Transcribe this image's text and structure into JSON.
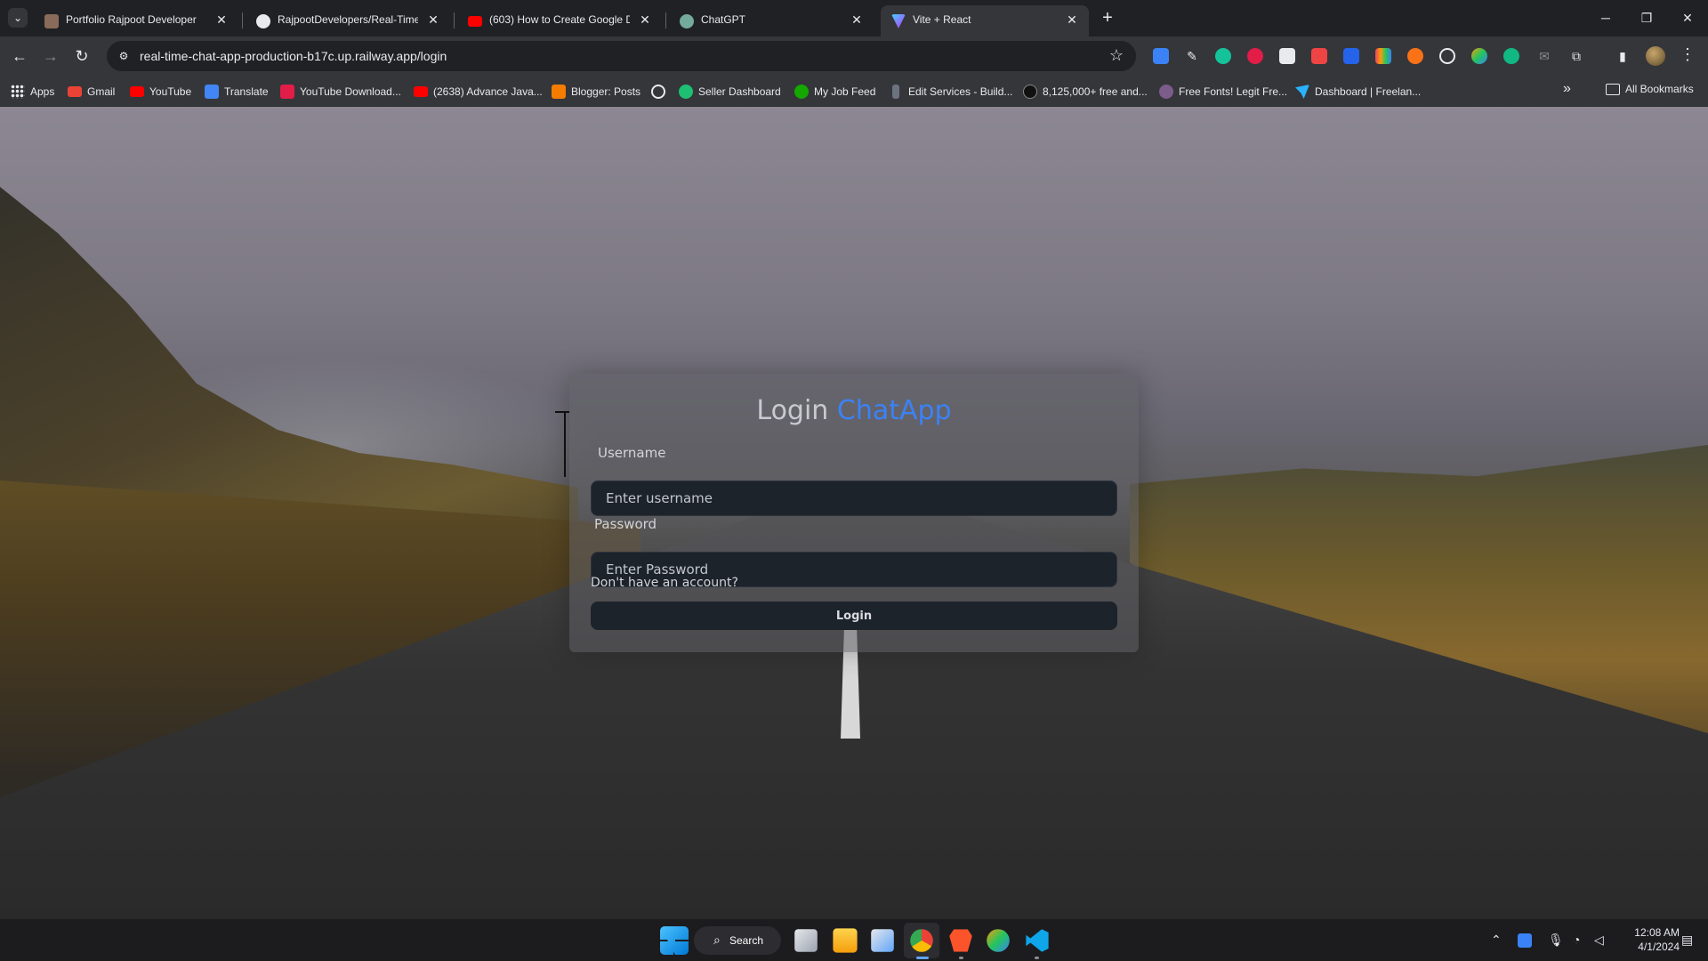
{
  "browser": {
    "tabs": [
      {
        "title": "Portfolio Rajpoot Developer",
        "icon": "portfolio-favicon",
        "color": "#8a6a5a"
      },
      {
        "title": "RajpootDevelopers/Real-Time-",
        "icon": "github-icon",
        "color": "#e8eaed"
      },
      {
        "title": "(603) How to Create Google Dr",
        "icon": "youtube-icon",
        "color": "#ff0000"
      },
      {
        "title": "ChatGPT",
        "icon": "chatgpt-icon",
        "color": "#74aa9c"
      },
      {
        "title": "Vite + React",
        "icon": "vite-icon",
        "color": "#a855f7"
      }
    ],
    "active_tab_index": 4,
    "address_bar": {
      "url": "real-time-chat-app-production-b17c.up.railway.app/login"
    },
    "bookmarks": [
      {
        "label": "Apps",
        "icon": "apps-grid-icon"
      },
      {
        "label": "Gmail",
        "icon": "gmail-icon"
      },
      {
        "label": "YouTube",
        "icon": "youtube-icon"
      },
      {
        "label": "Translate",
        "icon": "translate-icon"
      },
      {
        "label": "YouTube Download...",
        "icon": "download-icon"
      },
      {
        "label": "(2638) Advance Java...",
        "icon": "youtube-icon"
      },
      {
        "label": "Blogger: Posts",
        "icon": "blogger-icon"
      },
      {
        "label": "",
        "icon": "globe-icon"
      },
      {
        "label": "Seller Dashboard",
        "icon": "fiverr-icon"
      },
      {
        "label": "My Job Feed",
        "icon": "upwork-icon"
      },
      {
        "label": "Edit Services - Build...",
        "icon": "service-icon"
      },
      {
        "label": "8,125,000+ free and...",
        "icon": "freepik-icon"
      },
      {
        "label": "Free Fonts! Legit Fre...",
        "icon": "fonts-icon"
      },
      {
        "label": "Dashboard | Freelan...",
        "icon": "freelancer-icon"
      }
    ],
    "all_bookmarks_label": "All Bookmarks"
  },
  "login": {
    "title_prefix": "Login",
    "title_brand": "ChatApp",
    "username_label": "Username",
    "username_placeholder": "Enter username",
    "password_label": "Password",
    "password_placeholder": "Enter Password",
    "signup_link": "Don't have an account?",
    "submit_label": "Login",
    "brand_color": "#3b82f6"
  },
  "taskbar": {
    "search_label": "Search",
    "time": "12:08 AM",
    "date": "4/1/2024"
  }
}
